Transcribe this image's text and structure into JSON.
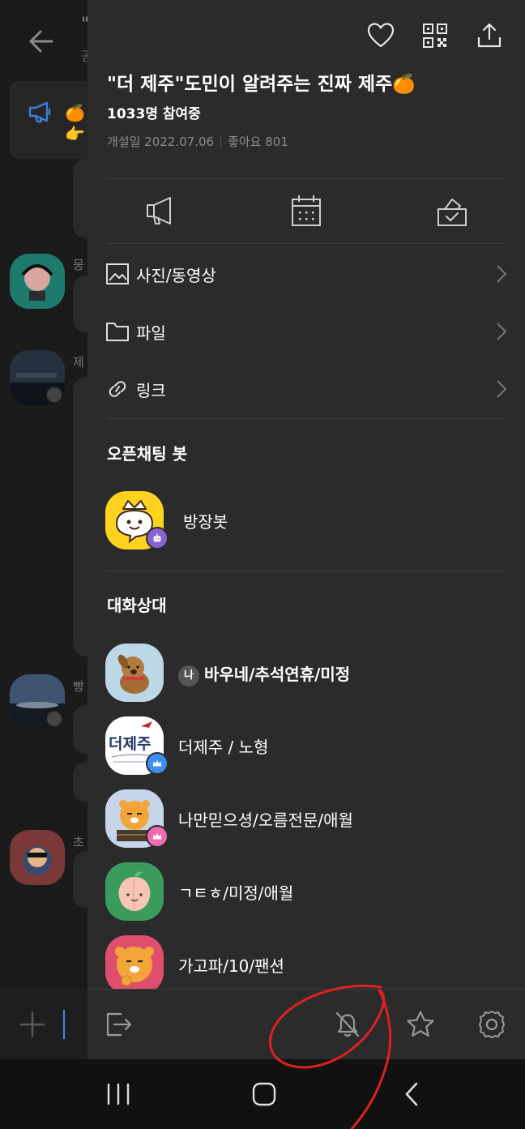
{
  "background": {
    "title_fragment": "\"",
    "subtitle_fragment": "공",
    "notice_emoji": "🍊\n👉",
    "names": [
      "뭉",
      "제",
      "빵",
      "초"
    ]
  },
  "header": {
    "title": "\"더 제주\"도민이 알려주는 진짜 제주🍊",
    "participants": "1033명 참여중",
    "created": "개설일 2022.07.06",
    "likes": "좋아요 801"
  },
  "menu": [
    {
      "label": "사진/동영상",
      "icon": "image-icon"
    },
    {
      "label": "파일",
      "icon": "folder-icon"
    },
    {
      "label": "링크",
      "icon": "link-icon"
    }
  ],
  "bots": {
    "section_title": "오픈채팅 봇",
    "items": [
      {
        "name": "방장봇"
      }
    ]
  },
  "members": {
    "section_title": "대화상대",
    "me_tag": "나",
    "items": [
      {
        "name": "바우네/추석연휴/미정"
      },
      {
        "name": "더제주 / 노형",
        "logo_text": "더제주"
      },
      {
        "name": "나만믿으셩/오름전문/애월"
      },
      {
        "name": "ㄱㅌㅎ/미정/애월"
      },
      {
        "name": "가고파/10/팬션"
      }
    ]
  },
  "colors": {
    "drawer_bg": "#2b2b2b",
    "crown_blue": "#3b8ff0",
    "crown_pink": "#f06ab5",
    "bot_badge": "#8a63d2",
    "annotation": "#e0201e"
  }
}
